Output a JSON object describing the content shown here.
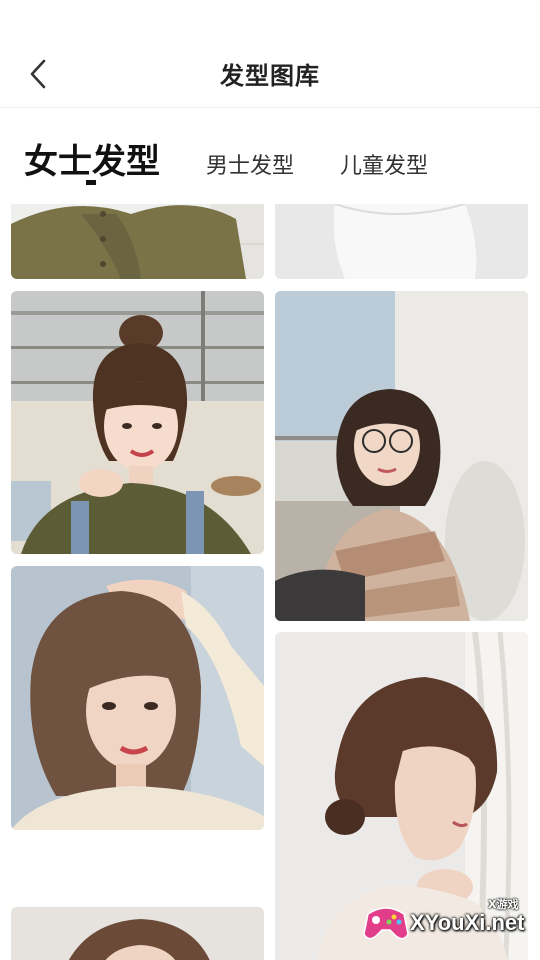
{
  "header": {
    "title": "发型图库",
    "back_icon": "chevron-left-icon"
  },
  "tabs": [
    {
      "label": "女士发型",
      "active": true
    },
    {
      "label": "男士发型",
      "active": false
    },
    {
      "label": "儿童发型",
      "active": false
    }
  ],
  "gallery": {
    "items": [
      {
        "subject": "woman in olive knit cardigan (cropped top)"
      },
      {
        "subject": "person in white top (cropped top)"
      },
      {
        "subject": "woman with high bun and bangs, olive sweater, denim overalls"
      },
      {
        "subject": "woman with glasses, shoulder-length bob, striped sweater"
      },
      {
        "subject": "woman with short layered bob and side bangs"
      },
      {
        "subject": "woman with low chignon, brown hair"
      },
      {
        "subject": "woman with brown hair (cropped bottom)"
      }
    ]
  },
  "watermark": {
    "small_text": "X游戏",
    "text": "XYouXi.net"
  },
  "colors": {
    "background": "#ffffff",
    "title": "#222222",
    "active_tab": "#111111",
    "divider": "#ececec"
  }
}
